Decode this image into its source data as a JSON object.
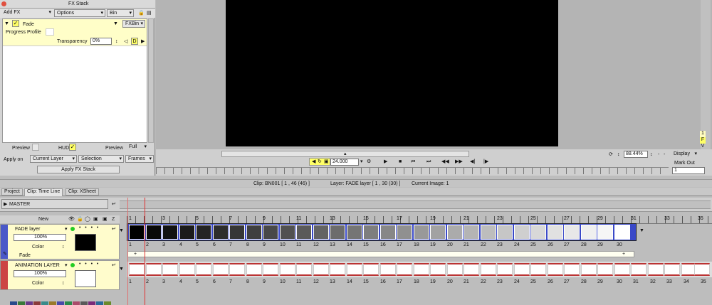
{
  "fx_stack": {
    "title": "FX Stack",
    "menu_add": "Add FX",
    "menu_options": "Options",
    "menu_bin": "Bin",
    "fx_name": "Fade",
    "fxbin": "FXBin",
    "progress_profile": "Progress Profile",
    "transparency_label": "Transparency",
    "transparency_value": "0%",
    "d_button": "D",
    "preview_label": "Preview",
    "hud_label": "HUD",
    "preview2_label": "Preview",
    "preview2_value": "Full",
    "apply_on_label": "Apply on",
    "apply_on_value": "Current Layer",
    "selection_value": "Selection",
    "frames_value": "Frames",
    "apply_button": "Apply FX Stack"
  },
  "viewer": {
    "fps": "24.000",
    "zoom": "88.44%",
    "display": "Display",
    "mark_out": "Mark Out",
    "mark_out_value": "1",
    "side_f": "F",
    "side_v": "V",
    "side_1": "1"
  },
  "status": {
    "clip": "Clip: BN001 [ 1 , 46  (46) ]",
    "layer": "Layer: FADE layer [ 1 , 30  (30) ]",
    "image": "Current Image: 1"
  },
  "tabs": [
    "Project",
    "Clip: Time Line",
    "Clip: XSheet"
  ],
  "master": "MASTER",
  "header": {
    "new": "New",
    "z": "Z"
  },
  "layers": [
    {
      "name": "FADE layer",
      "opacity": "100%",
      "color_label": "Color",
      "sub": "Fade",
      "bar_plus": "+"
    },
    {
      "name": "ANIMATION LAYER",
      "opacity": "100%",
      "color_label": "Color"
    }
  ],
  "ruler": [
    "1",
    "3",
    "5",
    "7",
    "9",
    "11",
    "13",
    "15",
    "17",
    "19",
    "21",
    "23",
    "25",
    "27",
    "29",
    "31",
    "33",
    "35"
  ],
  "frames_top": [
    "1",
    "2",
    "3",
    "4",
    "5",
    "6",
    "7",
    "8",
    "9",
    "10",
    "11",
    "12",
    "13",
    "14",
    "15",
    "16",
    "17",
    "18",
    "19",
    "20",
    "21",
    "22",
    "23",
    "24",
    "25",
    "26",
    "27",
    "28",
    "29",
    "30"
  ],
  "frames_bottom": [
    "1",
    "2",
    "3",
    "4",
    "5",
    "6",
    "7",
    "8",
    "9",
    "10",
    "11",
    "12",
    "13",
    "14",
    "15",
    "16",
    "17",
    "18",
    "19",
    "20",
    "21",
    "22",
    "23",
    "24",
    "25",
    "26",
    "27",
    "28",
    "29",
    "30",
    "31",
    "32",
    "33",
    "34",
    "35"
  ],
  "colors": {
    "accent": "#ffff66",
    "panel": "#fffff0",
    "playhead": "#e03030",
    "fade_border": "#3a49c8",
    "anim_border": "#b53333"
  }
}
